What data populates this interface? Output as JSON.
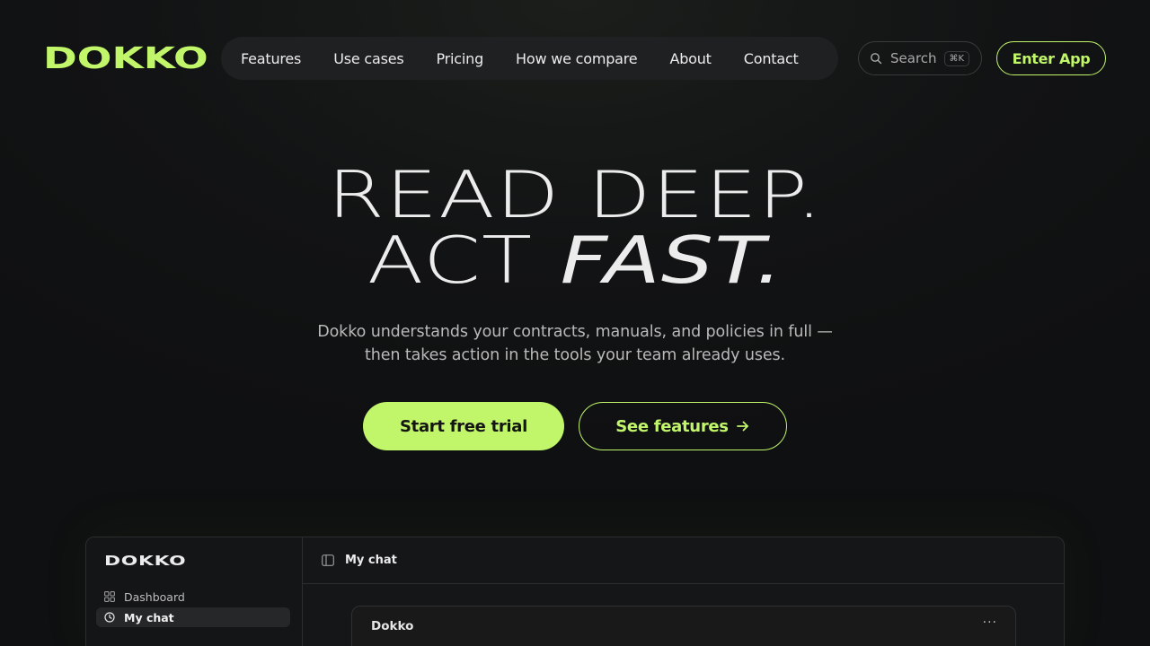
{
  "brand": {
    "logo": "DOKKO",
    "accent": "#c1f56a"
  },
  "nav": {
    "links": [
      {
        "label": "Features"
      },
      {
        "label": "Use cases"
      },
      {
        "label": "Pricing"
      },
      {
        "label": "How we compare"
      },
      {
        "label": "About"
      },
      {
        "label": "Contact"
      }
    ],
    "search_label": "Search",
    "search_shortcut": "⌘K",
    "search_icon": "search-icon",
    "enter_label": "Enter App"
  },
  "hero": {
    "line1": "READ DEEP.",
    "line2_plain": "ACT ",
    "line2_emph": "FAST.",
    "subtitle": "Dokko understands your contracts, manuals, and policies in full — then takes action in the tools your team already uses.",
    "primary_cta": "Start free trial",
    "secondary_cta": "See features",
    "secondary_icon": "arrow-right-icon"
  },
  "preview": {
    "logo": "DOKKO",
    "sidebar": [
      {
        "label": "Dashboard",
        "icon": "grid-icon"
      },
      {
        "label": "My chat",
        "icon": "clock-icon",
        "active": true
      }
    ],
    "header_title": "My chat",
    "header_icon": "sidebar-toggle-icon",
    "card_name": "Dokko",
    "card_menu": "···"
  }
}
